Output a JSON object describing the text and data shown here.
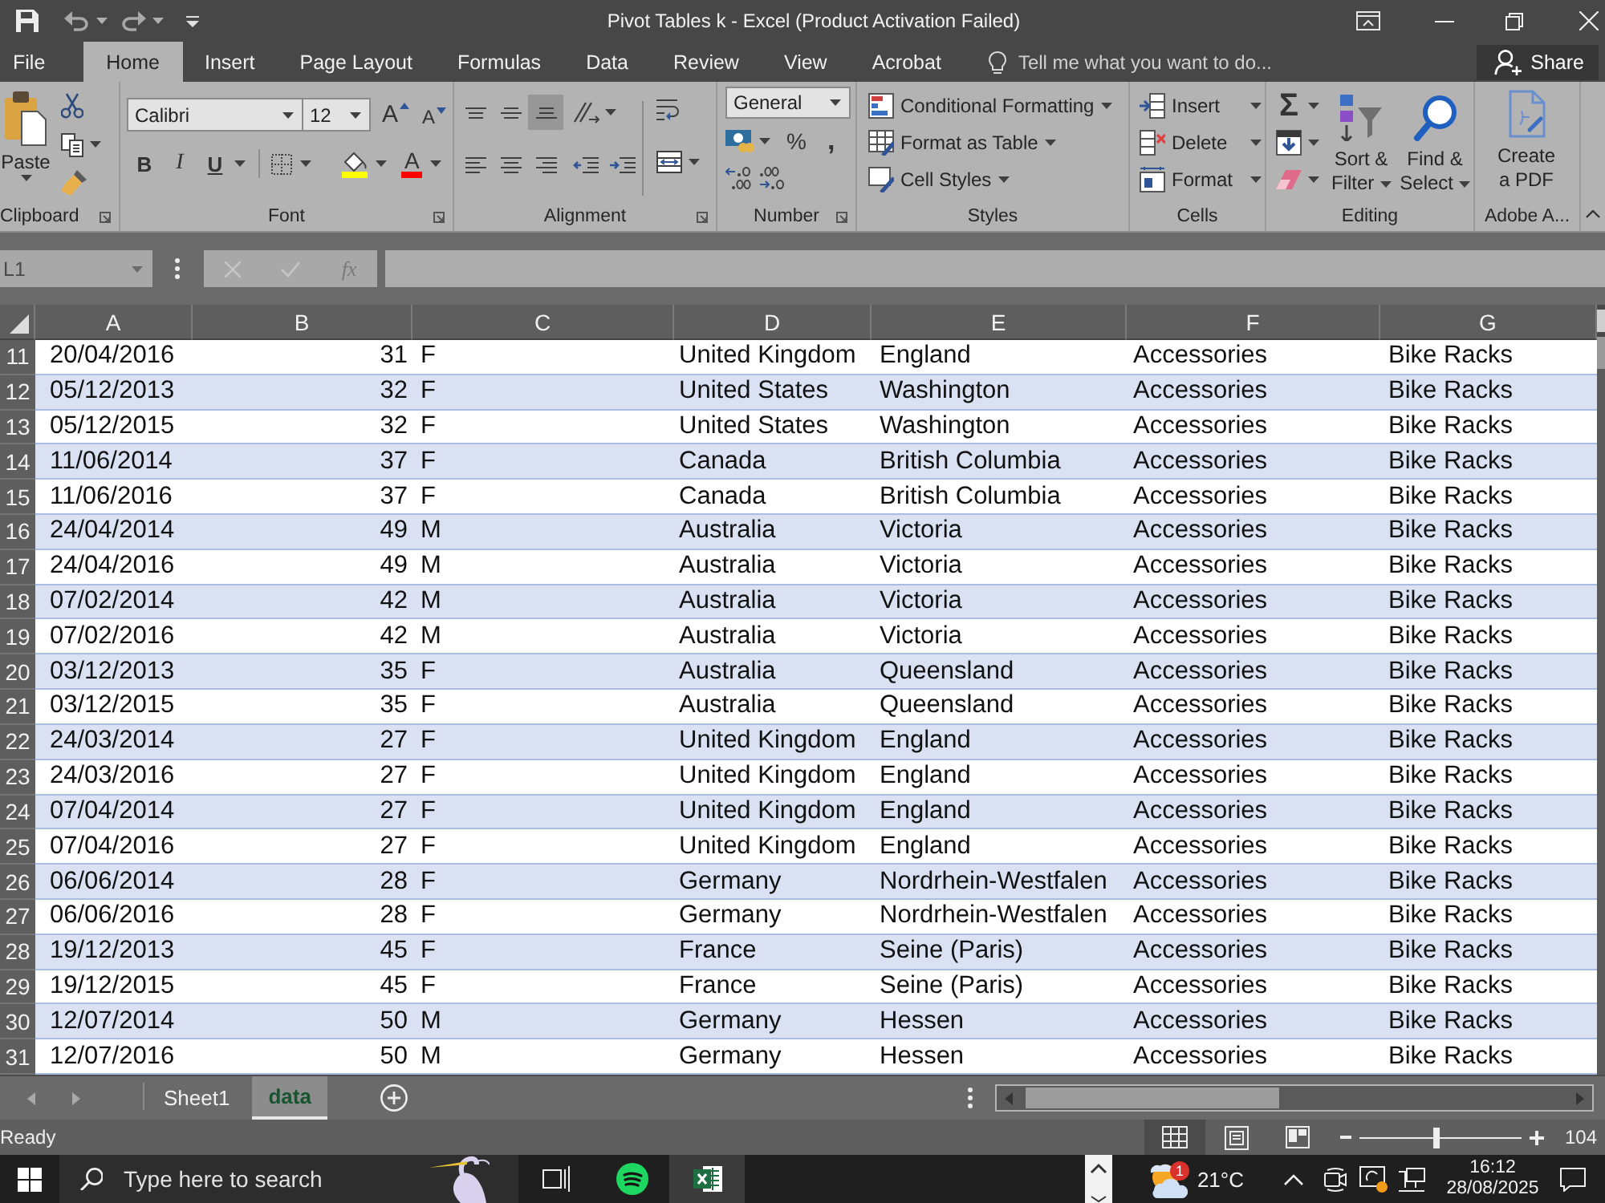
{
  "title_bar": {
    "title": "Pivot Tables k - Excel (Product Activation Failed)"
  },
  "ribbon_tabs": [
    {
      "label": "File",
      "selected": false
    },
    {
      "label": "Home",
      "selected": true
    },
    {
      "label": "Insert",
      "selected": false
    },
    {
      "label": "Page Layout",
      "selected": false
    },
    {
      "label": "Formulas",
      "selected": false
    },
    {
      "label": "Data",
      "selected": false
    },
    {
      "label": "Review",
      "selected": false
    },
    {
      "label": "View",
      "selected": false
    },
    {
      "label": "Acrobat",
      "selected": false
    }
  ],
  "tell_me": {
    "placeholder": "Tell me what you want to do..."
  },
  "share_button": {
    "label": "Share"
  },
  "ribbon": {
    "clipboard": {
      "label": "Clipboard",
      "paste": "Paste"
    },
    "font": {
      "label": "Font",
      "font_name": "Calibri",
      "font_size": "12",
      "grow": "A",
      "shrink": "A",
      "bold": "B",
      "italic": "I",
      "underline": "U",
      "font_color": "A"
    },
    "alignment": {
      "label": "Alignment",
      "vertical": [
        {
          "kind": "top",
          "selected": false
        },
        {
          "kind": "middle",
          "selected": false
        },
        {
          "kind": "bottom",
          "selected": true
        }
      ],
      "horizontal": [
        {
          "kind": "left",
          "selected": false
        },
        {
          "kind": "center",
          "selected": false
        },
        {
          "kind": "right",
          "selected": false
        }
      ]
    },
    "number": {
      "label": "Number",
      "format": "General",
      "percent": "%",
      "comma": ","
    },
    "styles": {
      "label": "Styles",
      "items": [
        {
          "kind": "conditional",
          "label": "Conditional Formatting"
        },
        {
          "kind": "table",
          "label": "Format as Table"
        },
        {
          "kind": "cell",
          "label": "Cell Styles"
        }
      ]
    },
    "cells": {
      "label": "Cells",
      "items": [
        {
          "kind": "insert",
          "label": "Insert"
        },
        {
          "kind": "delete",
          "label": "Delete"
        },
        {
          "kind": "format",
          "label": "Format"
        }
      ]
    },
    "editing": {
      "label": "Editing",
      "autosum": "Σ",
      "sort_filter": "Sort & Filter",
      "find_select": "Find & Select"
    },
    "acrobat": {
      "label": "Adobe A...",
      "create_pdf": "Create a PDF"
    }
  },
  "formula_bar": {
    "name_box": "L1",
    "edit_buttons_disabled": true,
    "function_button": "fx"
  },
  "sheet": {
    "columns": [
      "A",
      "B",
      "C",
      "D",
      "E",
      "F",
      "G"
    ],
    "rows": [
      {
        "number": "11",
        "cells": [
          "20/04/2016",
          "31",
          "F",
          "United Kingdom",
          "England",
          "Accessories",
          "Bike Racks"
        ]
      },
      {
        "number": "12",
        "cells": [
          "05/12/2013",
          "32",
          "F",
          "United States",
          "Washington",
          "Accessories",
          "Bike Racks"
        ]
      },
      {
        "number": "13",
        "cells": [
          "05/12/2015",
          "32",
          "F",
          "United States",
          "Washington",
          "Accessories",
          "Bike Racks"
        ]
      },
      {
        "number": "14",
        "cells": [
          "11/06/2014",
          "37",
          "F",
          "Canada",
          "British Columbia",
          "Accessories",
          "Bike Racks"
        ]
      },
      {
        "number": "15",
        "cells": [
          "11/06/2016",
          "37",
          "F",
          "Canada",
          "British Columbia",
          "Accessories",
          "Bike Racks"
        ]
      },
      {
        "number": "16",
        "cells": [
          "24/04/2014",
          "49",
          "M",
          "Australia",
          "Victoria",
          "Accessories",
          "Bike Racks"
        ]
      },
      {
        "number": "17",
        "cells": [
          "24/04/2016",
          "49",
          "M",
          "Australia",
          "Victoria",
          "Accessories",
          "Bike Racks"
        ]
      },
      {
        "number": "18",
        "cells": [
          "07/02/2014",
          "42",
          "M",
          "Australia",
          "Victoria",
          "Accessories",
          "Bike Racks"
        ]
      },
      {
        "number": "19",
        "cells": [
          "07/02/2016",
          "42",
          "M",
          "Australia",
          "Victoria",
          "Accessories",
          "Bike Racks"
        ]
      },
      {
        "number": "20",
        "cells": [
          "03/12/2013",
          "35",
          "F",
          "Australia",
          "Queensland",
          "Accessories",
          "Bike Racks"
        ]
      },
      {
        "number": "21",
        "cells": [
          "03/12/2015",
          "35",
          "F",
          "Australia",
          "Queensland",
          "Accessories",
          "Bike Racks"
        ]
      },
      {
        "number": "22",
        "cells": [
          "24/03/2014",
          "27",
          "F",
          "United Kingdom",
          "England",
          "Accessories",
          "Bike Racks"
        ]
      },
      {
        "number": "23",
        "cells": [
          "24/03/2016",
          "27",
          "F",
          "United Kingdom",
          "England",
          "Accessories",
          "Bike Racks"
        ]
      },
      {
        "number": "24",
        "cells": [
          "07/04/2014",
          "27",
          "F",
          "United Kingdom",
          "England",
          "Accessories",
          "Bike Racks"
        ]
      },
      {
        "number": "25",
        "cells": [
          "07/04/2016",
          "27",
          "F",
          "United Kingdom",
          "England",
          "Accessories",
          "Bike Racks"
        ]
      },
      {
        "number": "26",
        "cells": [
          "06/06/2014",
          "28",
          "F",
          "Germany",
          "Nordrhein-Westfalen",
          "Accessories",
          "Bike Racks"
        ]
      },
      {
        "number": "27",
        "cells": [
          "06/06/2016",
          "28",
          "F",
          "Germany",
          "Nordrhein-Westfalen",
          "Accessories",
          "Bike Racks"
        ]
      },
      {
        "number": "28",
        "cells": [
          "19/12/2013",
          "45",
          "F",
          "France",
          "Seine (Paris)",
          "Accessories",
          "Bike Racks"
        ]
      },
      {
        "number": "29",
        "cells": [
          "19/12/2015",
          "45",
          "F",
          "France",
          "Seine (Paris)",
          "Accessories",
          "Bike Racks"
        ]
      },
      {
        "number": "30",
        "cells": [
          "12/07/2014",
          "50",
          "M",
          "Germany",
          "Hessen",
          "Accessories",
          "Bike Racks"
        ]
      },
      {
        "number": "31",
        "cells": [
          "12/07/2016",
          "50",
          "M",
          "Germany",
          "Hessen",
          "Accessories",
          "Bike Racks"
        ]
      }
    ]
  },
  "sheet_tabs": [
    {
      "label": "Sheet1",
      "selected": false
    },
    {
      "label": "data",
      "selected": true
    }
  ],
  "status_bar": {
    "status": "Ready",
    "views": [
      {
        "kind": "normal",
        "selected": true
      },
      {
        "kind": "page_layout",
        "selected": false
      },
      {
        "kind": "page_break",
        "selected": false
      }
    ],
    "zoom": {
      "level": 0.48,
      "reading": "104"
    }
  },
  "taskbar": {
    "search": {
      "placeholder": "Type here to search"
    },
    "apps": [
      {
        "kind": "task_view",
        "selected": false
      },
      {
        "kind": "music",
        "selected": false
      },
      {
        "kind": "spreadsheet",
        "selected": true
      }
    ],
    "weather": {
      "badge": "1",
      "temperature": "21°C"
    },
    "clock": {
      "time": "16:12",
      "date": "28/08/2025"
    }
  }
}
